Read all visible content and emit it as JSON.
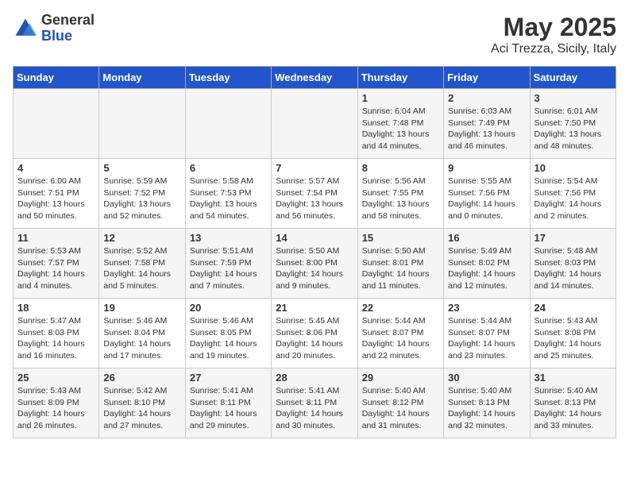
{
  "header": {
    "logo_general": "General",
    "logo_blue": "Blue",
    "title": "May 2025",
    "subtitle": "Aci Trezza, Sicily, Italy"
  },
  "days_of_week": [
    "Sunday",
    "Monday",
    "Tuesday",
    "Wednesday",
    "Thursday",
    "Friday",
    "Saturday"
  ],
  "weeks": [
    [
      {
        "day": "",
        "info": ""
      },
      {
        "day": "",
        "info": ""
      },
      {
        "day": "",
        "info": ""
      },
      {
        "day": "",
        "info": ""
      },
      {
        "day": "1",
        "info": "Sunrise: 6:04 AM\nSunset: 7:48 PM\nDaylight: 13 hours\nand 44 minutes."
      },
      {
        "day": "2",
        "info": "Sunrise: 6:03 AM\nSunset: 7:49 PM\nDaylight: 13 hours\nand 46 minutes."
      },
      {
        "day": "3",
        "info": "Sunrise: 6:01 AM\nSunset: 7:50 PM\nDaylight: 13 hours\nand 48 minutes."
      }
    ],
    [
      {
        "day": "4",
        "info": "Sunrise: 6:00 AM\nSunset: 7:51 PM\nDaylight: 13 hours\nand 50 minutes."
      },
      {
        "day": "5",
        "info": "Sunrise: 5:59 AM\nSunset: 7:52 PM\nDaylight: 13 hours\nand 52 minutes."
      },
      {
        "day": "6",
        "info": "Sunrise: 5:58 AM\nSunset: 7:53 PM\nDaylight: 13 hours\nand 54 minutes."
      },
      {
        "day": "7",
        "info": "Sunrise: 5:57 AM\nSunset: 7:54 PM\nDaylight: 13 hours\nand 56 minutes."
      },
      {
        "day": "8",
        "info": "Sunrise: 5:56 AM\nSunset: 7:55 PM\nDaylight: 13 hours\nand 58 minutes."
      },
      {
        "day": "9",
        "info": "Sunrise: 5:55 AM\nSunset: 7:56 PM\nDaylight: 14 hours\nand 0 minutes."
      },
      {
        "day": "10",
        "info": "Sunrise: 5:54 AM\nSunset: 7:56 PM\nDaylight: 14 hours\nand 2 minutes."
      }
    ],
    [
      {
        "day": "11",
        "info": "Sunrise: 5:53 AM\nSunset: 7:57 PM\nDaylight: 14 hours\nand 4 minutes."
      },
      {
        "day": "12",
        "info": "Sunrise: 5:52 AM\nSunset: 7:58 PM\nDaylight: 14 hours\nand 5 minutes."
      },
      {
        "day": "13",
        "info": "Sunrise: 5:51 AM\nSunset: 7:59 PM\nDaylight: 14 hours\nand 7 minutes."
      },
      {
        "day": "14",
        "info": "Sunrise: 5:50 AM\nSunset: 8:00 PM\nDaylight: 14 hours\nand 9 minutes."
      },
      {
        "day": "15",
        "info": "Sunrise: 5:50 AM\nSunset: 8:01 PM\nDaylight: 14 hours\nand 11 minutes."
      },
      {
        "day": "16",
        "info": "Sunrise: 5:49 AM\nSunset: 8:02 PM\nDaylight: 14 hours\nand 12 minutes."
      },
      {
        "day": "17",
        "info": "Sunrise: 5:48 AM\nSunset: 8:03 PM\nDaylight: 14 hours\nand 14 minutes."
      }
    ],
    [
      {
        "day": "18",
        "info": "Sunrise: 5:47 AM\nSunset: 8:03 PM\nDaylight: 14 hours\nand 16 minutes."
      },
      {
        "day": "19",
        "info": "Sunrise: 5:46 AM\nSunset: 8:04 PM\nDaylight: 14 hours\nand 17 minutes."
      },
      {
        "day": "20",
        "info": "Sunrise: 5:46 AM\nSunset: 8:05 PM\nDaylight: 14 hours\nand 19 minutes."
      },
      {
        "day": "21",
        "info": "Sunrise: 5:45 AM\nSunset: 8:06 PM\nDaylight: 14 hours\nand 20 minutes."
      },
      {
        "day": "22",
        "info": "Sunrise: 5:44 AM\nSunset: 8:07 PM\nDaylight: 14 hours\nand 22 minutes."
      },
      {
        "day": "23",
        "info": "Sunrise: 5:44 AM\nSunset: 8:07 PM\nDaylight: 14 hours\nand 23 minutes."
      },
      {
        "day": "24",
        "info": "Sunrise: 5:43 AM\nSunset: 8:08 PM\nDaylight: 14 hours\nand 25 minutes."
      }
    ],
    [
      {
        "day": "25",
        "info": "Sunrise: 5:43 AM\nSunset: 8:09 PM\nDaylight: 14 hours\nand 26 minutes."
      },
      {
        "day": "26",
        "info": "Sunrise: 5:42 AM\nSunset: 8:10 PM\nDaylight: 14 hours\nand 27 minutes."
      },
      {
        "day": "27",
        "info": "Sunrise: 5:41 AM\nSunset: 8:11 PM\nDaylight: 14 hours\nand 29 minutes."
      },
      {
        "day": "28",
        "info": "Sunrise: 5:41 AM\nSunset: 8:11 PM\nDaylight: 14 hours\nand 30 minutes."
      },
      {
        "day": "29",
        "info": "Sunrise: 5:40 AM\nSunset: 8:12 PM\nDaylight: 14 hours\nand 31 minutes."
      },
      {
        "day": "30",
        "info": "Sunrise: 5:40 AM\nSunset: 8:13 PM\nDaylight: 14 hours\nand 32 minutes."
      },
      {
        "day": "31",
        "info": "Sunrise: 5:40 AM\nSunset: 8:13 PM\nDaylight: 14 hours\nand 33 minutes."
      }
    ]
  ]
}
